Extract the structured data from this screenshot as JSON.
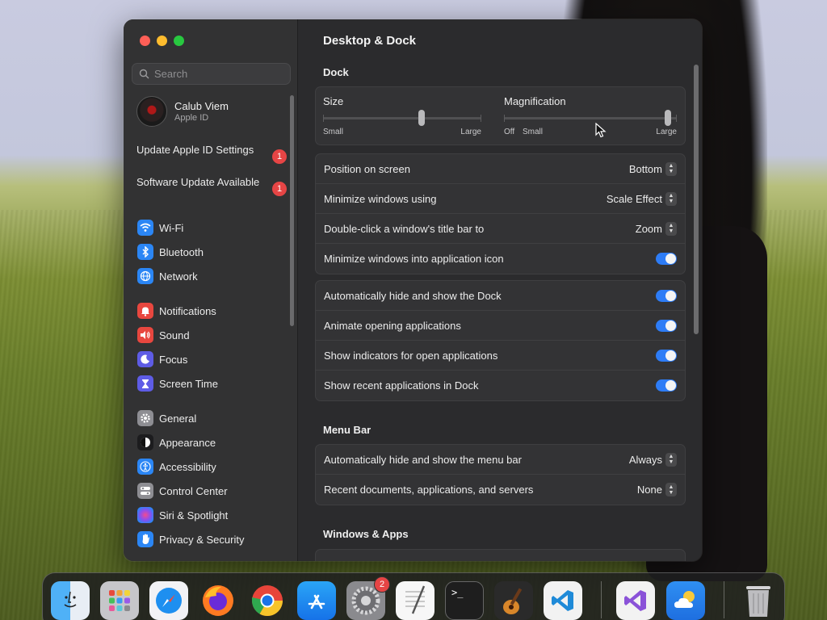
{
  "sidebar": {
    "search_placeholder": "Search",
    "account": {
      "name": "Calub Viem",
      "subtitle": "Apple ID"
    },
    "notices": [
      {
        "label": "Update Apple ID Settings",
        "badge": "1"
      },
      {
        "label": "Software Update Available",
        "badge": "1"
      }
    ],
    "items": [
      {
        "label": "Wi-Fi",
        "icon": "wifi-icon",
        "color": "#2b86f5"
      },
      {
        "label": "Bluetooth",
        "icon": "bluetooth-icon",
        "color": "#2b86f5"
      },
      {
        "label": "Network",
        "icon": "globe-icon",
        "color": "#2b86f5"
      },
      {
        "label": "Notifications",
        "icon": "bell-icon",
        "color": "#e8473f"
      },
      {
        "label": "Sound",
        "icon": "speaker-icon",
        "color": "#e8473f"
      },
      {
        "label": "Focus",
        "icon": "moon-icon",
        "color": "#5e5ce6"
      },
      {
        "label": "Screen Time",
        "icon": "hourglass-icon",
        "color": "#5e5ce6"
      },
      {
        "label": "General",
        "icon": "gear-icon",
        "color": "#8e8e93"
      },
      {
        "label": "Appearance",
        "icon": "appearance-icon",
        "color": "#1c1c1e"
      },
      {
        "label": "Accessibility",
        "icon": "accessibility-icon",
        "color": "#2b86f5"
      },
      {
        "label": "Control Center",
        "icon": "control-center-icon",
        "color": "#8e8e93"
      },
      {
        "label": "Siri & Spotlight",
        "icon": "siri-icon",
        "color": "#b04ad8"
      },
      {
        "label": "Privacy & Security",
        "icon": "hand-icon",
        "color": "#2b86f5"
      }
    ]
  },
  "content": {
    "title": "Desktop & Dock",
    "dock_section": "Dock",
    "size": {
      "label": "Size",
      "min_label": "Small",
      "max_label": "Large",
      "value": 0.62
    },
    "magnification": {
      "label": "Magnification",
      "off_label": "Off",
      "min_label": "Small",
      "max_label": "Large",
      "value": 0.95
    },
    "group1": [
      {
        "label": "Position on screen",
        "value": "Bottom",
        "kind": "popup"
      },
      {
        "label": "Minimize windows using",
        "value": "Scale Effect",
        "kind": "popup"
      },
      {
        "label": "Double-click a window's title bar to",
        "value": "Zoom",
        "kind": "popup"
      },
      {
        "label": "Minimize windows into application icon",
        "value": "on",
        "kind": "toggle"
      }
    ],
    "group2": [
      {
        "label": "Automatically hide and show the Dock",
        "value": "on"
      },
      {
        "label": "Animate opening applications",
        "value": "on"
      },
      {
        "label": "Show indicators for open applications",
        "value": "on"
      },
      {
        "label": "Show recent applications in Dock",
        "value": "on"
      }
    ],
    "menu_bar_section": "Menu Bar",
    "menu_bar": [
      {
        "label": "Automatically hide and show the menu bar",
        "value": "Always"
      },
      {
        "label": "Recent documents, applications, and servers",
        "value": "None"
      }
    ],
    "windows_section": "Windows & Apps"
  },
  "dock": {
    "apps": [
      {
        "name": "Finder",
        "icon": "finder-icon",
        "color": "#3d9bf0"
      },
      {
        "name": "Launchpad",
        "icon": "launchpad-icon",
        "color": "#c8c8cc"
      },
      {
        "name": "Safari",
        "icon": "safari-icon",
        "color": "#f2f2f5"
      },
      {
        "name": "Firefox",
        "icon": "firefox-icon",
        "color": "#2a1a4a"
      },
      {
        "name": "Chrome",
        "icon": "chrome-icon",
        "color": "#f2f2f2"
      },
      {
        "name": "App Store",
        "icon": "app-store-icon",
        "color": "#1b8cf3"
      },
      {
        "name": "System Settings",
        "icon": "settings-icon",
        "color": "#8a8a8e",
        "badge": "2"
      },
      {
        "name": "TextEdit",
        "icon": "textedit-icon",
        "color": "#f5f5f5"
      },
      {
        "name": "Terminal",
        "icon": "terminal-icon",
        "color": "#1e1e1e"
      },
      {
        "name": "GarageBand",
        "icon": "garageband-icon",
        "color": "#2a2a2a"
      },
      {
        "name": "VS Code",
        "icon": "vscode-icon",
        "color": "#f2f2f2"
      },
      {
        "name": "Visual Studio",
        "icon": "visual-studio-icon",
        "color": "#f2f2f2"
      },
      {
        "name": "Weather",
        "icon": "weather-icon",
        "color": "#2f8ff2"
      },
      {
        "name": "Trash",
        "icon": "trash-icon",
        "color": "#c8c8ca"
      }
    ]
  }
}
